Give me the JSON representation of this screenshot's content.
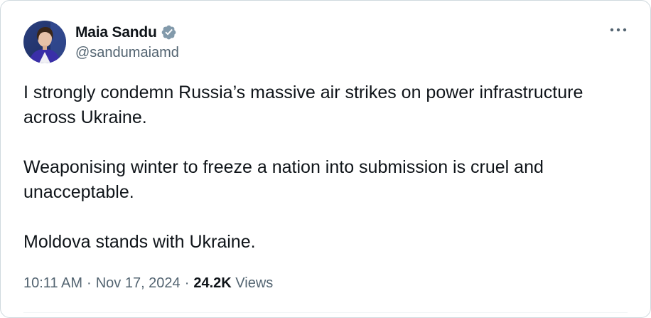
{
  "author": {
    "display_name": "Maia Sandu",
    "handle": "@sandumaiamd",
    "verified": true,
    "avatar_icon": "profile-photo"
  },
  "menu": {
    "more_icon": "ellipsis-icon"
  },
  "tweet": {
    "paragraphs": [
      "I strongly condemn Russia’s massive air strikes on power infrastructure across Ukraine.",
      "Weaponising winter to freeze a nation into submission is cruel and unacceptable.",
      "Moldova stands with Ukraine."
    ]
  },
  "meta": {
    "time": "10:11 AM",
    "separator": "·",
    "date": "Nov 17, 2024",
    "views_count": "24.2K",
    "views_label": "Views"
  },
  "colors": {
    "text_primary": "#0f1419",
    "text_secondary": "#536471",
    "verified_badge": "#829aab",
    "border": "#cfd9de"
  }
}
